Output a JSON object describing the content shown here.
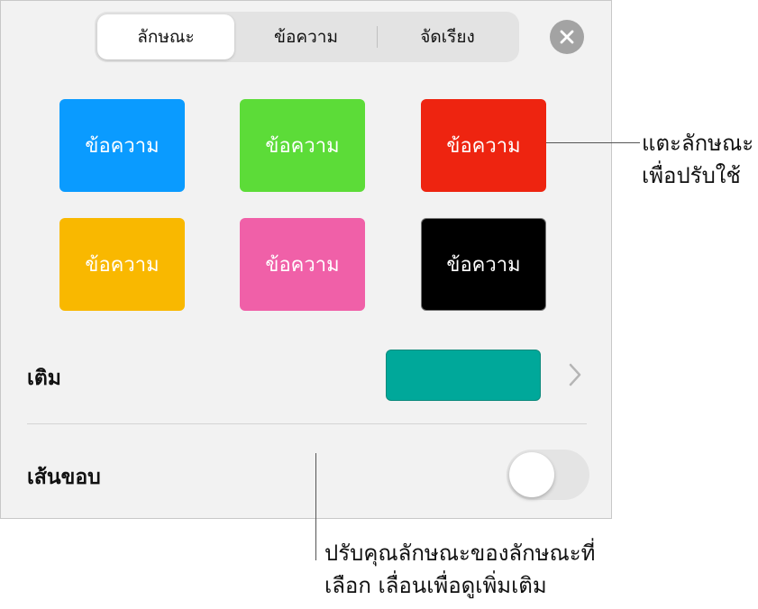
{
  "tabs": [
    {
      "label": "ลักษณะ",
      "selected": true
    },
    {
      "label": "ข้อความ",
      "selected": false
    },
    {
      "label": "จัดเรียง",
      "selected": false
    }
  ],
  "close_icon": "close-icon",
  "styles": [
    {
      "label": "ข้อความ",
      "color": "#0a9bff"
    },
    {
      "label": "ข้อความ",
      "color": "#5cdc38"
    },
    {
      "label": "ข้อความ",
      "color": "#ee2410"
    },
    {
      "label": "ข้อความ",
      "color": "#f9b800"
    },
    {
      "label": "ข้อความ",
      "color": "#f060a8"
    },
    {
      "label": "ข้อความ",
      "color": "#000000"
    }
  ],
  "fill": {
    "label": "เติม",
    "color": "#00a89a"
  },
  "border": {
    "label": "เส้นขอบ",
    "enabled": false
  },
  "callouts": {
    "apply_style": [
      "แตะลักษณะ",
      "เพื่อปรับใช้"
    ],
    "adjust_attributes": [
      "ปรับคุณลักษณะของลักษณะที่",
      "เลือก เลื่อนเพื่อดูเพิ่มเติม"
    ]
  }
}
